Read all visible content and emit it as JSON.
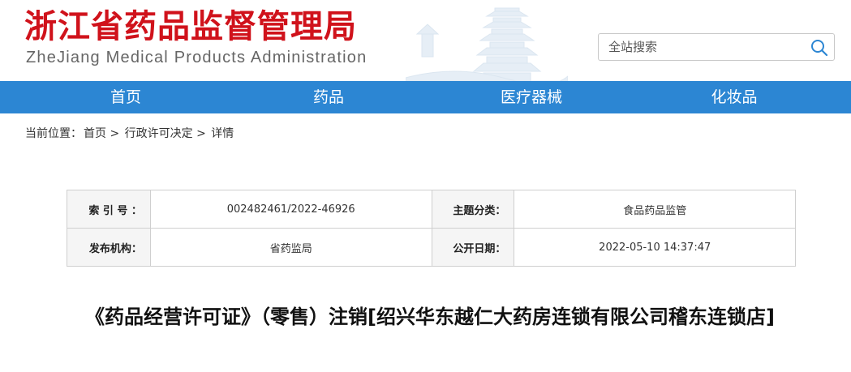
{
  "header": {
    "title": "浙江省药品监督管理局",
    "subtitle": "ZheJiang Medical Products Administration"
  },
  "search": {
    "placeholder": "全站搜索",
    "icon": "search-icon"
  },
  "nav": {
    "items": [
      {
        "label": "首页"
      },
      {
        "label": "药品"
      },
      {
        "label": "医疗器械"
      },
      {
        "label": "化妆品"
      }
    ]
  },
  "breadcrumb": {
    "prefix": "当前位置：",
    "items": [
      "首页",
      "行政许可决定",
      "详情"
    ],
    "separator": ">"
  },
  "meta": {
    "index_label": "索 引 号 ：",
    "index_value": "002482461/2022-46926",
    "category_label": "主题分类：",
    "category_value": "食品药品监管",
    "publisher_label": "发布机构：",
    "publisher_value": "省药监局",
    "date_label": "公开日期：",
    "date_value": "2022-05-10 14:37:47"
  },
  "article": {
    "title": "《药品经营许可证》（零售）注销[绍兴华东越仁大药房连锁有限公司稽东连锁店]"
  },
  "colors": {
    "brand_red": "#d0121b",
    "nav_blue": "#2c86d3"
  }
}
